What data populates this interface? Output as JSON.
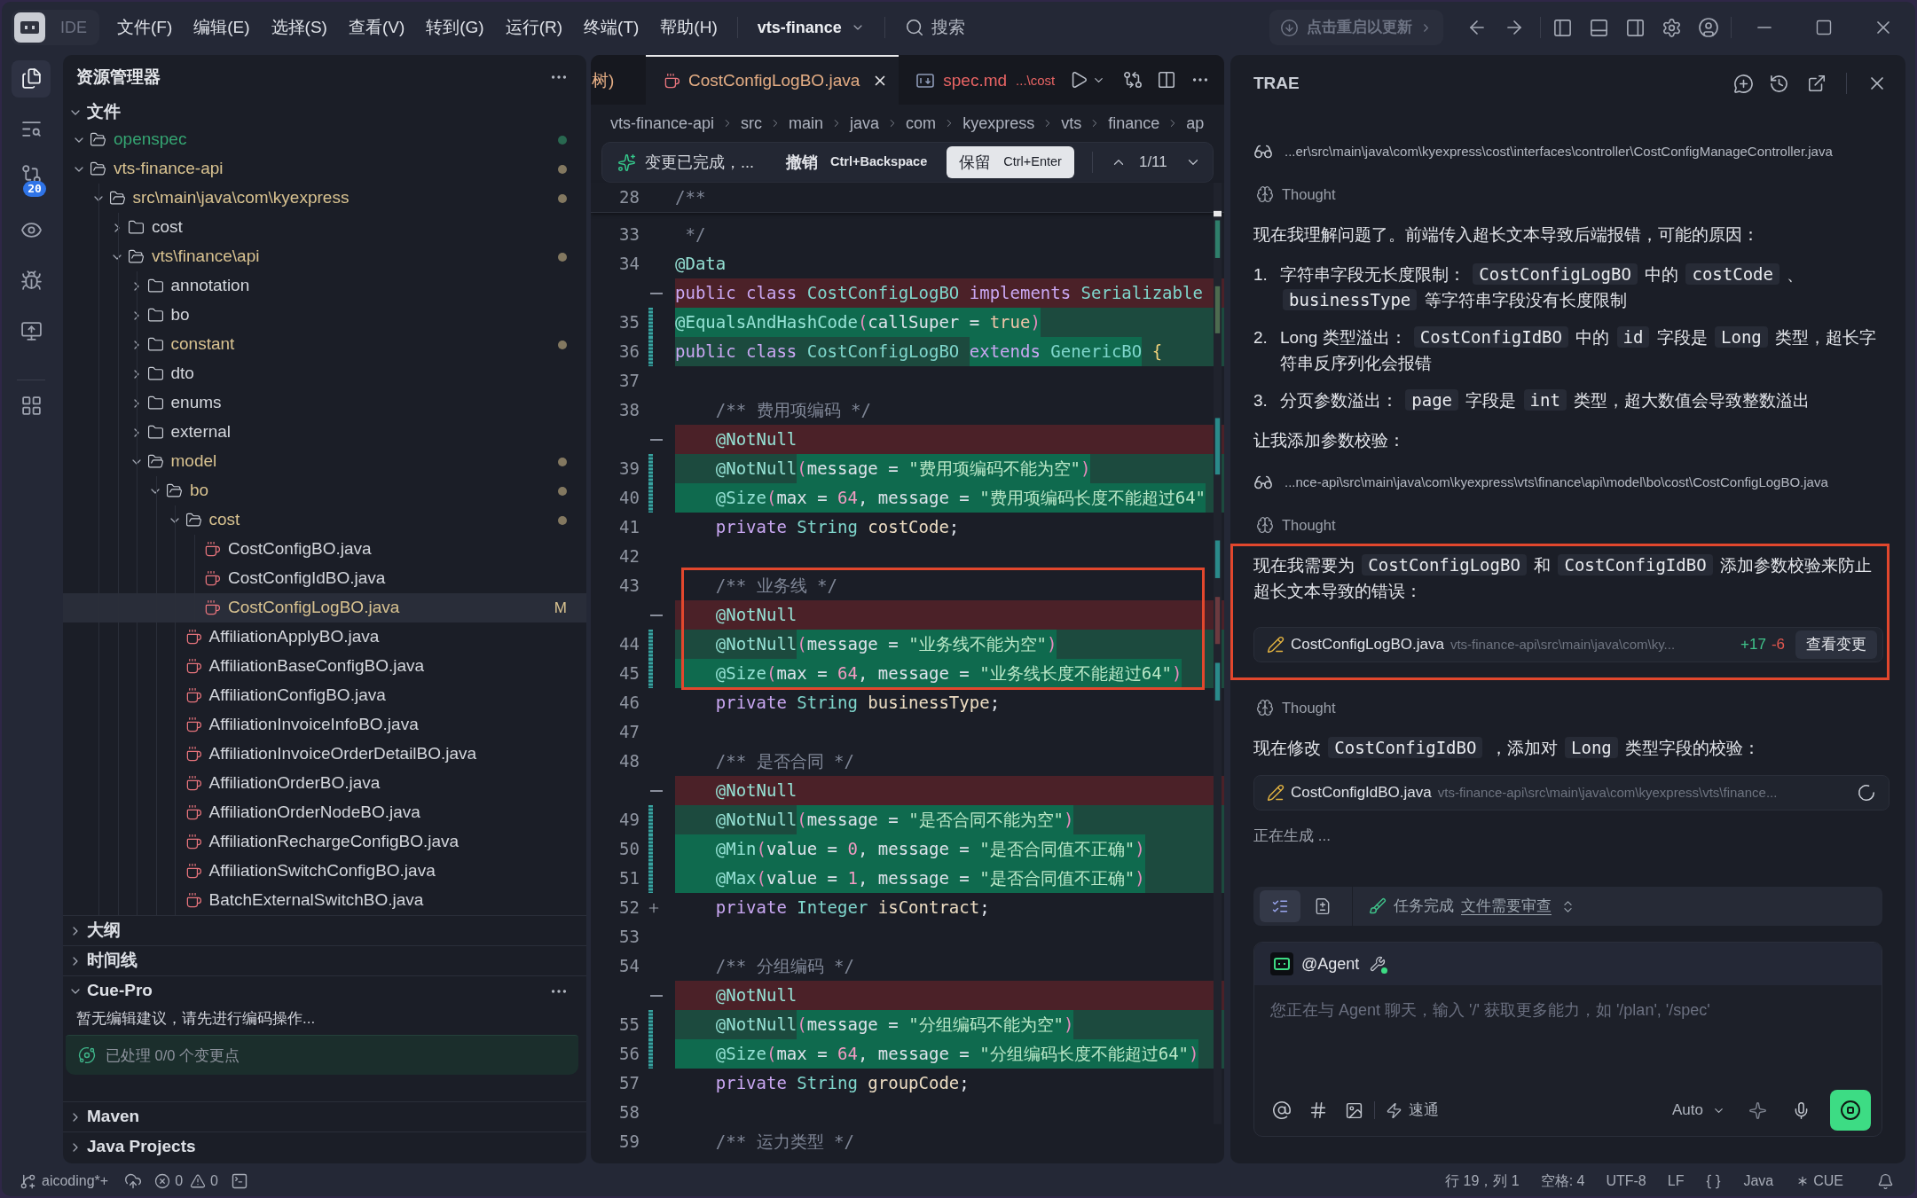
{
  "title_bar": {
    "mode_switch": {
      "label": "IDE",
      "on": false
    },
    "menus": [
      "文件(F)",
      "编辑(E)",
      "选择(S)",
      "查看(V)",
      "转到(G)",
      "运行(R)",
      "终端(T)",
      "帮助(H)"
    ],
    "project": "vts-finance",
    "search": {
      "placeholder": "搜索"
    },
    "update_button": "点击重启以更新"
  },
  "activity_bar": [
    {
      "kind": "explorer",
      "selected": true
    },
    {
      "kind": "search",
      "selected": false
    },
    {
      "kind": "source_control",
      "selected": false,
      "badge": "20"
    },
    {
      "kind": "preview",
      "selected": false
    },
    {
      "kind": "debug",
      "selected": false
    },
    {
      "kind": "remote",
      "selected": false
    },
    {
      "kind": "extensions",
      "selected": false
    }
  ],
  "explorer": {
    "title": "资源管理器",
    "section": {
      "title": "文件",
      "expanded": true
    },
    "tree": [
      {
        "name": "openspec",
        "kind": "folder",
        "expanded": true,
        "color": "#35a572",
        "selected": false
      },
      {
        "name": "vts-finance-api",
        "kind": "folder",
        "expanded": true,
        "color": "#d8c290",
        "selected": false,
        "children": [
          {
            "name": "src\\main\\java\\com\\kyexpress",
            "kind": "folder",
            "expanded": true,
            "color": "#d8c290",
            "selected": false,
            "children": [
              {
                "name": "cost",
                "kind": "folder",
                "expanded": false,
                "selected": false
              },
              {
                "name": "vts\\finance\\api",
                "kind": "folder",
                "expanded": true,
                "color": "#d8c290",
                "selected": false,
                "children": [
                  {
                    "name": "annotation",
                    "kind": "folder",
                    "expanded": false,
                    "selected": false
                  },
                  {
                    "name": "bo",
                    "kind": "folder",
                    "expanded": false,
                    "selected": false
                  },
                  {
                    "name": "constant",
                    "kind": "folder",
                    "expanded": false,
                    "color": "#d8c290",
                    "selected": false
                  },
                  {
                    "name": "dto",
                    "kind": "folder",
                    "expanded": false,
                    "selected": false
                  },
                  {
                    "name": "enums",
                    "kind": "folder",
                    "expanded": false,
                    "selected": false
                  },
                  {
                    "name": "external",
                    "kind": "folder",
                    "expanded": false,
                    "selected": false
                  },
                  {
                    "name": "model",
                    "kind": "folder",
                    "expanded": true,
                    "color": "#d8c290",
                    "selected": false,
                    "children": [
                      {
                        "name": "bo",
                        "kind": "folder",
                        "expanded": true,
                        "color": "#d8c290",
                        "selected": false,
                        "children": [
                          {
                            "name": "cost",
                            "kind": "folder",
                            "expanded": true,
                            "color": "#d8c290",
                            "selected": false,
                            "children": [
                              {
                                "name": "CostConfigBO.java",
                                "kind": "file",
                                "selected": false
                              },
                              {
                                "name": "CostConfigIdBO.java",
                                "kind": "file",
                                "selected": false
                              },
                              {
                                "name": "CostConfigLogBO.java",
                                "kind": "file",
                                "color": "#d8c290",
                                "selected": true,
                                "badge": "M"
                              }
                            ]
                          },
                          {
                            "name": "AffiliationApplyBO.java",
                            "kind": "file",
                            "selected": false
                          },
                          {
                            "name": "AffiliationBaseConfigBO.java",
                            "kind": "file",
                            "selected": false
                          },
                          {
                            "name": "AffiliationConfigBO.java",
                            "kind": "file",
                            "selected": false
                          },
                          {
                            "name": "AffiliationInvoiceInfoBO.java",
                            "kind": "file",
                            "selected": false
                          },
                          {
                            "name": "AffiliationInvoiceOrderDetailBO.java",
                            "kind": "file",
                            "selected": false
                          },
                          {
                            "name": "AffiliationOrderBO.java",
                            "kind": "file",
                            "selected": false
                          },
                          {
                            "name": "AffiliationOrderNodeBO.java",
                            "kind": "file",
                            "selected": false
                          },
                          {
                            "name": "AffiliationRechargeConfigBO.java",
                            "kind": "file",
                            "selected": false
                          },
                          {
                            "name": "AffiliationSwitchConfigBO.java",
                            "kind": "file",
                            "selected": false
                          },
                          {
                            "name": "BatchExternalSwitchBO.java",
                            "kind": "file",
                            "selected": false
                          }
                        ]
                      }
                    ]
                  }
                ]
              }
            ]
          }
        ]
      }
    ],
    "panels": [
      {
        "title": "大纲",
        "expanded": false
      },
      {
        "title": "时间线",
        "expanded": false
      },
      {
        "title": "Cue-Pro",
        "expanded": true,
        "message": "暂无编辑建议，请先进行编码操作...",
        "progress": "已处理 0/0 个变更点"
      },
      {
        "title": "Maven",
        "expanded": false
      },
      {
        "title": "Java Projects",
        "expanded": false
      }
    ]
  },
  "editor": {
    "tabs": [
      {
        "label": "树)",
        "color": "#e4ad84",
        "selected": false
      },
      {
        "label": "CostConfigLogBO.java",
        "kind": "java",
        "color": "#e4ad84",
        "selected": true
      },
      {
        "label": "spec.md",
        "description": "...\\cost",
        "kind": "markdown",
        "color": "#e86464",
        "selected": false
      }
    ],
    "breadcrumb": [
      "vts-finance-api",
      "src",
      "main",
      "java",
      "com",
      "kyexpress",
      "vts",
      "finance",
      "ap"
    ],
    "change_bar": {
      "status": "变更已完成，...",
      "undo_label": "撤销",
      "undo_shortcut": "Ctrl+Backspace",
      "keep_label": "保留",
      "keep_shortcut": "Ctrl+Enter",
      "counter": "1/11"
    },
    "sticky_line": {
      "number": "28",
      "tokens": [
        {
          "text": "/**",
          "kind": "comment"
        }
      ]
    },
    "lines": [
      {
        "number": "33",
        "kind": "context",
        "indented": false,
        "framed": false,
        "tokens": [
          {
            "text": " */",
            "kind": "comment"
          }
        ]
      },
      {
        "number": "34",
        "kind": "context",
        "indented": false,
        "framed": false,
        "tokens": [
          {
            "text": "@Data",
            "kind": "annotation"
          }
        ]
      },
      {
        "kind": "deleted",
        "indented": false,
        "framed": false,
        "tokens": [
          {
            "text": "public ",
            "kind": "keyword"
          },
          {
            "text": "class ",
            "kind": "keyword"
          },
          {
            "text": "CostConfigLogBO ",
            "kind": "type"
          },
          {
            "text": "implements ",
            "kind": "keyword"
          },
          {
            "text": "Serializable",
            "kind": "type"
          }
        ]
      },
      {
        "number": "35",
        "kind": "added",
        "indented": false,
        "framed": false,
        "tokens": [
          {
            "text": "@EqualsAndHashCode",
            "kind": "annotation",
            "changed": true
          },
          {
            "text": "(",
            "kind": "paren",
            "changed": true
          },
          {
            "text": "callSuper",
            "kind": "param",
            "changed": true
          },
          {
            "text": " = ",
            "kind": "operator",
            "changed": true
          },
          {
            "text": "true",
            "kind": "literal",
            "changed": true
          },
          {
            "text": ")",
            "kind": "paren",
            "changed": true
          }
        ]
      },
      {
        "number": "36",
        "kind": "added",
        "indented": false,
        "framed": false,
        "tokens": [
          {
            "text": "public ",
            "kind": "keyword",
            "changed": false
          },
          {
            "text": "class ",
            "kind": "keyword",
            "changed": false
          },
          {
            "text": "CostConfigLogBO ",
            "kind": "type",
            "changed": false
          },
          {
            "text": "extends ",
            "kind": "keyword",
            "changed": true
          },
          {
            "text": "GenericBO",
            "kind": "type",
            "changed": true
          },
          {
            "text": " {",
            "kind": "brace",
            "changed": false
          }
        ]
      },
      {
        "number": "37",
        "kind": "context",
        "framed": false
      },
      {
        "number": "38",
        "kind": "context",
        "indented": true,
        "framed": false,
        "tokens": [
          {
            "text": "/** 费用项编码 */",
            "kind": "comment"
          }
        ]
      },
      {
        "kind": "deleted",
        "indented": true,
        "framed": false,
        "tokens": [
          {
            "text": "@NotNull",
            "kind": "annotation"
          }
        ]
      },
      {
        "number": "39",
        "kind": "added",
        "indented": true,
        "framed": false,
        "tokens": [
          {
            "text": "@NotNull",
            "kind": "annotation",
            "changed": false
          },
          {
            "text": "(",
            "kind": "paren",
            "changed": true
          },
          {
            "text": "message",
            "kind": "param",
            "changed": true
          },
          {
            "text": " = ",
            "kind": "operator",
            "changed": true
          },
          {
            "text": "\"费用项编码不能为空\"",
            "kind": "string",
            "changed": true
          },
          {
            "text": ")",
            "kind": "paren",
            "changed": true
          }
        ]
      },
      {
        "number": "40",
        "kind": "added",
        "indented": true,
        "framed": false,
        "tokens": [
          {
            "text": "@Size",
            "kind": "annotation",
            "changed": true
          },
          {
            "text": "(",
            "kind": "paren",
            "changed": true
          },
          {
            "text": "max",
            "kind": "param",
            "changed": true
          },
          {
            "text": " = ",
            "kind": "operator",
            "changed": true
          },
          {
            "text": "64",
            "kind": "number",
            "changed": true
          },
          {
            "text": ", ",
            "kind": "operator",
            "changed": true
          },
          {
            "text": "message",
            "kind": "param",
            "changed": true
          },
          {
            "text": " = ",
            "kind": "operator",
            "changed": true
          },
          {
            "text": "\"费用项编码长度不能超过64\"",
            "kind": "string",
            "changed": true
          }
        ]
      },
      {
        "number": "41",
        "kind": "context",
        "indented": true,
        "framed": false,
        "tokens": [
          {
            "text": "private ",
            "kind": "keyword"
          },
          {
            "text": "String ",
            "kind": "type"
          },
          {
            "text": "costCode",
            "kind": "field"
          },
          {
            "text": ";",
            "kind": "punct"
          }
        ]
      },
      {
        "number": "42",
        "kind": "context",
        "framed": false
      },
      {
        "number": "43",
        "kind": "context",
        "indented": true,
        "framed": true,
        "tokens": [
          {
            "text": "/** 业务线 */",
            "kind": "comment"
          }
        ]
      },
      {
        "kind": "deleted",
        "indented": true,
        "framed": true,
        "tokens": [
          {
            "text": "@NotNull",
            "kind": "annotation"
          }
        ]
      },
      {
        "number": "44",
        "kind": "added",
        "indented": true,
        "framed": true,
        "tokens": [
          {
            "text": "@NotNull",
            "kind": "annotation",
            "changed": false
          },
          {
            "text": "(",
            "kind": "paren",
            "changed": true
          },
          {
            "text": "message",
            "kind": "param",
            "changed": true
          },
          {
            "text": " = ",
            "kind": "operator",
            "changed": true
          },
          {
            "text": "\"业务线不能为空\"",
            "kind": "string",
            "changed": true
          },
          {
            "text": ")",
            "kind": "paren",
            "changed": true
          }
        ]
      },
      {
        "number": "45",
        "kind": "added",
        "indented": true,
        "framed": true,
        "tokens": [
          {
            "text": "@Size",
            "kind": "annotation",
            "changed": true
          },
          {
            "text": "(",
            "kind": "paren",
            "changed": true
          },
          {
            "text": "max",
            "kind": "param",
            "changed": true
          },
          {
            "text": " = ",
            "kind": "operator",
            "changed": true
          },
          {
            "text": "64",
            "kind": "number",
            "changed": true
          },
          {
            "text": ", ",
            "kind": "operator",
            "changed": true
          },
          {
            "text": "message",
            "kind": "param",
            "changed": true
          },
          {
            "text": " = ",
            "kind": "operator",
            "changed": true
          },
          {
            "text": "\"业务线长度不能超过64\"",
            "kind": "string",
            "changed": true
          },
          {
            "text": ")",
            "kind": "paren",
            "changed": true
          }
        ]
      },
      {
        "number": "46",
        "kind": "context",
        "indented": true,
        "framed": false,
        "tokens": [
          {
            "text": "private ",
            "kind": "keyword"
          },
          {
            "text": "String ",
            "kind": "type"
          },
          {
            "text": "businessType",
            "kind": "field"
          },
          {
            "text": ";",
            "kind": "punct"
          }
        ]
      },
      {
        "number": "47",
        "kind": "context",
        "framed": false
      },
      {
        "number": "48",
        "kind": "context",
        "indented": true,
        "framed": false,
        "tokens": [
          {
            "text": "/** 是否合同 */",
            "kind": "comment"
          }
        ]
      },
      {
        "kind": "deleted",
        "indented": true,
        "framed": false,
        "tokens": [
          {
            "text": "@NotNull",
            "kind": "annotation"
          }
        ]
      },
      {
        "number": "49",
        "kind": "added",
        "indented": true,
        "framed": false,
        "tokens": [
          {
            "text": "@NotNull",
            "kind": "annotation",
            "changed": false
          },
          {
            "text": "(",
            "kind": "paren",
            "changed": true
          },
          {
            "text": "message",
            "kind": "param",
            "changed": true
          },
          {
            "text": " = ",
            "kind": "operator",
            "changed": true
          },
          {
            "text": "\"是否合同不能为空\"",
            "kind": "string",
            "changed": true
          },
          {
            "text": ")",
            "kind": "paren",
            "changed": true
          }
        ]
      },
      {
        "number": "50",
        "kind": "added",
        "indented": true,
        "framed": false,
        "tokens": [
          {
            "text": "@Min",
            "kind": "annotation",
            "changed": true
          },
          {
            "text": "(",
            "kind": "paren",
            "changed": true
          },
          {
            "text": "value",
            "kind": "param",
            "changed": true
          },
          {
            "text": " = ",
            "kind": "operator",
            "changed": true
          },
          {
            "text": "0",
            "kind": "number",
            "changed": true
          },
          {
            "text": ", ",
            "kind": "operator",
            "changed": true
          },
          {
            "text": "message",
            "kind": "param",
            "changed": true
          },
          {
            "text": " = ",
            "kind": "operator",
            "changed": true
          },
          {
            "text": "\"是否合同值不正确\"",
            "kind": "string",
            "changed": true
          },
          {
            "text": ")",
            "kind": "paren",
            "changed": true
          }
        ]
      },
      {
        "number": "51",
        "kind": "added",
        "indented": true,
        "framed": false,
        "tokens": [
          {
            "text": "@Max",
            "kind": "annotation",
            "changed": true
          },
          {
            "text": "(",
            "kind": "paren",
            "changed": true
          },
          {
            "text": "value",
            "kind": "param",
            "changed": true
          },
          {
            "text": " = ",
            "kind": "operator",
            "changed": true
          },
          {
            "text": "1",
            "kind": "number",
            "changed": true
          },
          {
            "text": ", ",
            "kind": "operator",
            "changed": true
          },
          {
            "text": "message",
            "kind": "param",
            "changed": true
          },
          {
            "text": " = ",
            "kind": "operator",
            "changed": true
          },
          {
            "text": "\"是否合同值不正确\"",
            "kind": "string",
            "changed": true
          },
          {
            "text": ")",
            "kind": "paren",
            "changed": true
          }
        ]
      },
      {
        "number": "52",
        "kind": "context_hover",
        "indented": true,
        "framed": false,
        "tokens": [
          {
            "text": "private ",
            "kind": "keyword"
          },
          {
            "text": "Integer ",
            "kind": "type"
          },
          {
            "text": "isContract",
            "kind": "field"
          },
          {
            "text": ";",
            "kind": "punct"
          }
        ]
      },
      {
        "number": "53",
        "kind": "context",
        "framed": false
      },
      {
        "number": "54",
        "kind": "context",
        "indented": true,
        "framed": false,
        "tokens": [
          {
            "text": "/** 分组编码 */",
            "kind": "comment"
          }
        ]
      },
      {
        "kind": "deleted",
        "indented": true,
        "framed": false,
        "tokens": [
          {
            "text": "@NotNull",
            "kind": "annotation"
          }
        ]
      },
      {
        "number": "55",
        "kind": "added",
        "indented": true,
        "framed": false,
        "tokens": [
          {
            "text": "@NotNull",
            "kind": "annotation",
            "changed": false
          },
          {
            "text": "(",
            "kind": "paren",
            "changed": true
          },
          {
            "text": "message",
            "kind": "param",
            "changed": true
          },
          {
            "text": " = ",
            "kind": "operator",
            "changed": true
          },
          {
            "text": "\"分组编码不能为空\"",
            "kind": "string",
            "changed": true
          },
          {
            "text": ")",
            "kind": "paren",
            "changed": true
          }
        ]
      },
      {
        "number": "56",
        "kind": "added",
        "indented": true,
        "framed": false,
        "tokens": [
          {
            "text": "@Size",
            "kind": "annotation",
            "changed": true
          },
          {
            "text": "(",
            "kind": "paren",
            "changed": true
          },
          {
            "text": "max",
            "kind": "param",
            "changed": true
          },
          {
            "text": " = ",
            "kind": "operator",
            "changed": true
          },
          {
            "text": "64",
            "kind": "number",
            "changed": true
          },
          {
            "text": ", ",
            "kind": "operator",
            "changed": true
          },
          {
            "text": "message",
            "kind": "param",
            "changed": true
          },
          {
            "text": " = ",
            "kind": "operator",
            "changed": true
          },
          {
            "text": "\"分组编码长度不能超过64\"",
            "kind": "string",
            "changed": true
          },
          {
            "text": ")",
            "kind": "paren",
            "changed": true
          }
        ]
      },
      {
        "number": "57",
        "kind": "context",
        "indented": true,
        "framed": false,
        "tokens": [
          {
            "text": "private ",
            "kind": "keyword"
          },
          {
            "text": "String ",
            "kind": "type"
          },
          {
            "text": "groupCode",
            "kind": "field"
          },
          {
            "text": ";",
            "kind": "punct"
          }
        ]
      },
      {
        "number": "58",
        "kind": "context",
        "framed": false
      },
      {
        "number": "59",
        "kind": "context",
        "indented": true,
        "framed": false,
        "tokens": [
          {
            "text": "/** 运力类型 */",
            "kind": "comment"
          }
        ]
      }
    ]
  },
  "assistant": {
    "title": "TRAE",
    "messages": [
      {
        "kind": "file_read",
        "path": "...er\\src\\main\\java\\com\\kyexpress\\cost\\interfaces\\controller\\CostConfigManageController.java",
        "framed": false
      },
      {
        "kind": "thought",
        "label": "Thought",
        "framed": false
      },
      {
        "kind": "paragraph",
        "parts": [
          {
            "text": "现在我理解问题了。前端传入超长文本导致后端报错，可能的原因：",
            "code": false
          }
        ],
        "framed": false
      },
      {
        "kind": "list",
        "framed": false,
        "items": [
          {
            "marker": "1.",
            "parts": [
              {
                "text": "字符串字段无长度限制：",
                "code": false
              },
              {
                "text": "CostConfigLogBO",
                "code": true
              },
              {
                "text": "中的",
                "code": false
              },
              {
                "text": "costCode",
                "code": true
              },
              {
                "text": "、",
                "code": false
              },
              {
                "text": "businessType",
                "code": true
              },
              {
                "text": "等字符串字段没有长度限制",
                "code": false
              }
            ]
          },
          {
            "marker": "2.",
            "parts": [
              {
                "text": "Long 类型溢出：",
                "code": false
              },
              {
                "text": "CostConfigIdBO",
                "code": true
              },
              {
                "text": "中的",
                "code": false
              },
              {
                "text": "id",
                "code": true
              },
              {
                "text": "字段是",
                "code": false
              },
              {
                "text": "Long",
                "code": true
              },
              {
                "text": "类型，超长字符串反序列化会报错",
                "code": false
              }
            ]
          },
          {
            "marker": "3.",
            "parts": [
              {
                "text": "分页参数溢出：",
                "code": false
              },
              {
                "text": "page",
                "code": true
              },
              {
                "text": "字段是",
                "code": false
              },
              {
                "text": "int",
                "code": true
              },
              {
                "text": "类型，超大数值会导致整数溢出",
                "code": false
              }
            ]
          }
        ]
      },
      {
        "kind": "paragraph",
        "parts": [
          {
            "text": "让我添加参数校验：",
            "code": false
          }
        ],
        "framed": false
      },
      {
        "kind": "file_read",
        "path": "...nce-api\\src\\main\\java\\com\\kyexpress\\vts\\finance\\api\\model\\bo\\cost\\CostConfigLogBO.java",
        "framed": false
      },
      {
        "kind": "thought",
        "label": "Thought",
        "framed": false
      },
      {
        "kind": "paragraph",
        "parts": [
          {
            "text": "现在我需要为",
            "code": false
          },
          {
            "text": "CostConfigLogBO",
            "code": true
          },
          {
            "text": "和",
            "code": false
          },
          {
            "text": "CostConfigIdBO",
            "code": true
          },
          {
            "text": "添加参数校验来防止超长文本导致的错误：",
            "code": false
          }
        ],
        "framed": true
      },
      {
        "kind": "file_edit",
        "file": "CostConfigLogBO.java",
        "path": "vts-finance-api\\src\\main\\java\\com\\ky...",
        "in_progress": false,
        "added": "+17",
        "removed": "-6",
        "action": "查看变更",
        "framed": true
      },
      {
        "kind": "thought",
        "label": "Thought",
        "framed": false
      },
      {
        "kind": "paragraph",
        "parts": [
          {
            "text": "现在修改",
            "code": false
          },
          {
            "text": "CostConfigIdBO",
            "code": true
          },
          {
            "text": "，添加对",
            "code": false
          },
          {
            "text": "Long",
            "code": true
          },
          {
            "text": "类型字段的校验：",
            "code": false
          }
        ],
        "framed": false
      },
      {
        "kind": "file_edit",
        "file": "CostConfigIdBO.java",
        "path": "vts-finance-api\\src\\main\\java\\com\\kyexpress\\vts\\finance...",
        "in_progress": true,
        "framed": false
      },
      {
        "kind": "status",
        "text": "正在生成 ...",
        "framed": false
      }
    ],
    "task_bar": {
      "toggles": [
        {
          "kind": "checklist",
          "selected": true
        },
        {
          "kind": "document",
          "selected": false
        }
      ],
      "status": "任务完成",
      "link": "文件需要审查"
    },
    "composer": {
      "agent": "@Agent",
      "placeholder": "您正在与 Agent 聊天，输入 '/' 获取更多能力，如 '/plan', '/spec'",
      "mode": "速通",
      "model": "Auto"
    }
  },
  "status_bar": {
    "branch": "aicoding*+",
    "errors": "0",
    "warnings": "0",
    "position": "行 19，列 1",
    "indentation": "空格: 4",
    "encoding": "UTF-8",
    "line_ending": "LF",
    "language": "Java",
    "extension": "CUE"
  }
}
